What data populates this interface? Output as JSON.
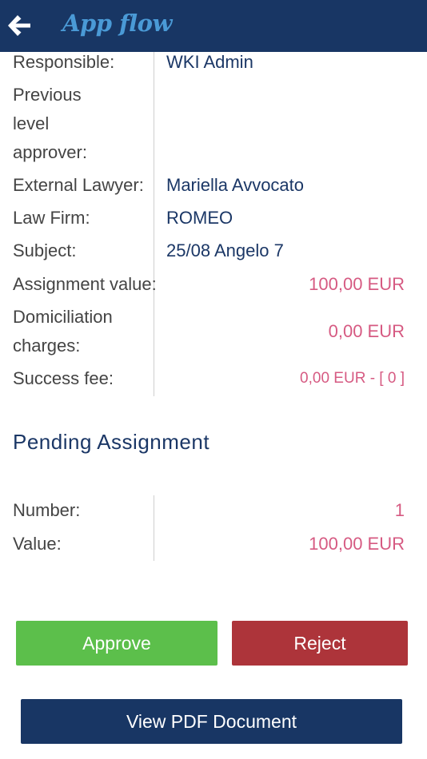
{
  "header": {
    "app_title": "App flow"
  },
  "details": {
    "responsible": {
      "label": "Responsible:",
      "value": "WKI Admin"
    },
    "previous_approver": {
      "label_line1": "Previous",
      "label_line2": "level",
      "label_line3": "approver:"
    },
    "external_lawyer": {
      "label": "External Lawyer:",
      "value": "Mariella Avvocato"
    },
    "law_firm": {
      "label": "Law Firm:",
      "value": "ROMEO"
    },
    "subject": {
      "label": "Subject:",
      "value": "25/08 Angelo 7"
    },
    "assignment_value": {
      "label": "Assignment value:",
      "value": "100,00 EUR"
    },
    "domiciliation": {
      "label_line1": "Domiciliation",
      "label_line2": "charges:",
      "value": "0,00 EUR"
    },
    "success_fee": {
      "label": "Success fee:",
      "value": "0,00 EUR - [ 0 ]"
    }
  },
  "pending": {
    "title": "Pending Assignment",
    "number": {
      "label": "Number:",
      "value": "1"
    },
    "value": {
      "label": "Value:",
      "value": "100,00 EUR"
    }
  },
  "actions": {
    "approve_label": "Approve",
    "reject_label": "Reject",
    "pdf_label": "View PDF Document"
  },
  "colors": {
    "header_bg": "#183664",
    "accent_value": "#d65a82",
    "approve": "#5cbf4b",
    "reject": "#ad343a"
  }
}
